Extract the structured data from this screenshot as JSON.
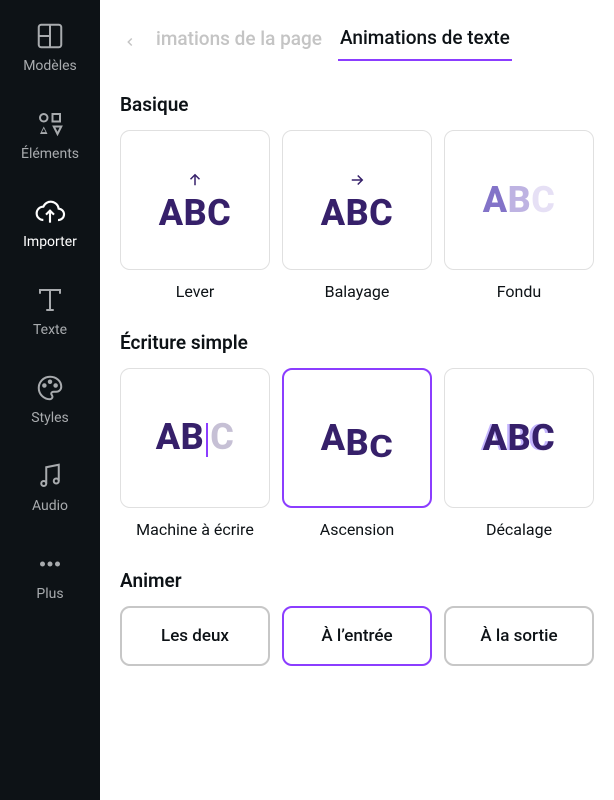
{
  "sidenav": [
    {
      "id": "templates",
      "label": "Modèles"
    },
    {
      "id": "elements",
      "label": "Éléments"
    },
    {
      "id": "uploads",
      "label": "Importer"
    },
    {
      "id": "text",
      "label": "Texte"
    },
    {
      "id": "styles",
      "label": "Styles"
    },
    {
      "id": "audio",
      "label": "Audio"
    },
    {
      "id": "more",
      "label": "Plus"
    }
  ],
  "sidenav_active": "uploads",
  "tabs": {
    "page": "imations de la page",
    "text": "Animations de texte"
  },
  "sections": {
    "basic": {
      "title": "Basique",
      "items": [
        {
          "key": "rise",
          "label": "Lever"
        },
        {
          "key": "pan",
          "label": "Balayage"
        },
        {
          "key": "fade",
          "label": "Fondu"
        }
      ]
    },
    "simple_writing": {
      "title": "Écriture simple",
      "items": [
        {
          "key": "typewriter",
          "label": "Machine à écrire"
        },
        {
          "key": "ascension",
          "label": "Ascension"
        },
        {
          "key": "shift",
          "label": "Décalage"
        }
      ]
    }
  },
  "animer": {
    "title": "Animer",
    "options": [
      {
        "key": "both",
        "label": "Les deux"
      },
      {
        "key": "in",
        "label": "À l’entrée"
      },
      {
        "key": "out",
        "label": "À la sortie"
      }
    ],
    "selected": "in"
  },
  "selected_animation": "ascension",
  "colors": {
    "accent": "#8b3dff",
    "text": "#36206a"
  }
}
